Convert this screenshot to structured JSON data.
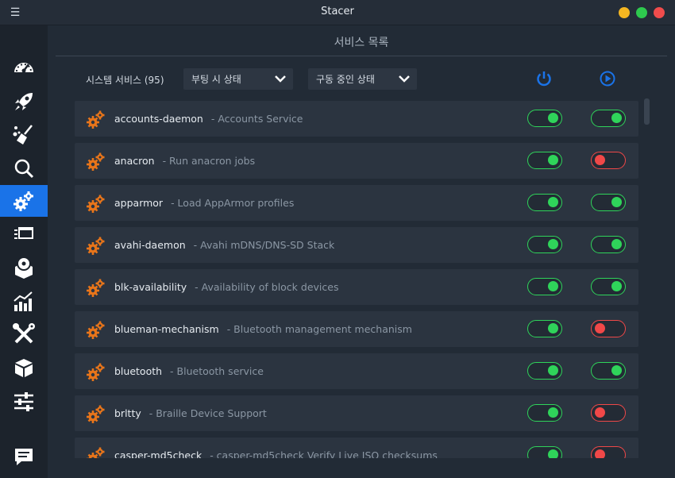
{
  "window": {
    "title": "Stacer",
    "menu_icon": "hamburger-icon"
  },
  "sidebar": {
    "items": [
      {
        "name": "dashboard",
        "icon": "speedometer-icon"
      },
      {
        "name": "startup-apps",
        "icon": "rocket-icon"
      },
      {
        "name": "system-cleaner",
        "icon": "broom-icon"
      },
      {
        "name": "search",
        "icon": "magnifier-icon"
      },
      {
        "name": "services",
        "icon": "gears-icon",
        "active": true
      },
      {
        "name": "processes",
        "icon": "window-stack-icon"
      },
      {
        "name": "uninstaller",
        "icon": "package-disc-icon"
      },
      {
        "name": "resources",
        "icon": "chart-icon"
      },
      {
        "name": "helpers",
        "icon": "tools-icon"
      },
      {
        "name": "apt-repository",
        "icon": "box-icon"
      },
      {
        "name": "settings",
        "icon": "sliders-icon"
      },
      {
        "name": "feedback",
        "icon": "chat-icon"
      }
    ]
  },
  "main": {
    "title": "서비스 목록",
    "toolbar": {
      "label": "시스템 서비스 (95)",
      "boot_filter": "부팅 시 상태",
      "running_filter": "구동 중인 상태",
      "boot_icon": "power-icon",
      "running_icon": "play-icon"
    },
    "services": [
      {
        "name": "accounts-daemon",
        "desc": "- Accounts Service",
        "boot": true,
        "running": true
      },
      {
        "name": "anacron",
        "desc": "- Run anacron jobs",
        "boot": true,
        "running": false
      },
      {
        "name": "apparmor",
        "desc": "- Load AppArmor profiles",
        "boot": true,
        "running": true
      },
      {
        "name": "avahi-daemon",
        "desc": "- Avahi mDNS/DNS-SD Stack",
        "boot": true,
        "running": true
      },
      {
        "name": "blk-availability",
        "desc": "- Availability of block devices",
        "boot": true,
        "running": true
      },
      {
        "name": "blueman-mechanism",
        "desc": "- Bluetooth management mechanism",
        "boot": true,
        "running": false
      },
      {
        "name": "bluetooth",
        "desc": "- Bluetooth service",
        "boot": true,
        "running": true
      },
      {
        "name": "brltty",
        "desc": "- Braille Device Support",
        "boot": true,
        "running": false
      },
      {
        "name": "casper-md5check",
        "desc": "- casper-md5check Verify Live ISO checksums",
        "boot": true,
        "running": false
      }
    ]
  },
  "colors": {
    "accent": "#1a73e8",
    "on": "#2fd45a",
    "off": "#f04848",
    "gear": "#e8751a"
  }
}
